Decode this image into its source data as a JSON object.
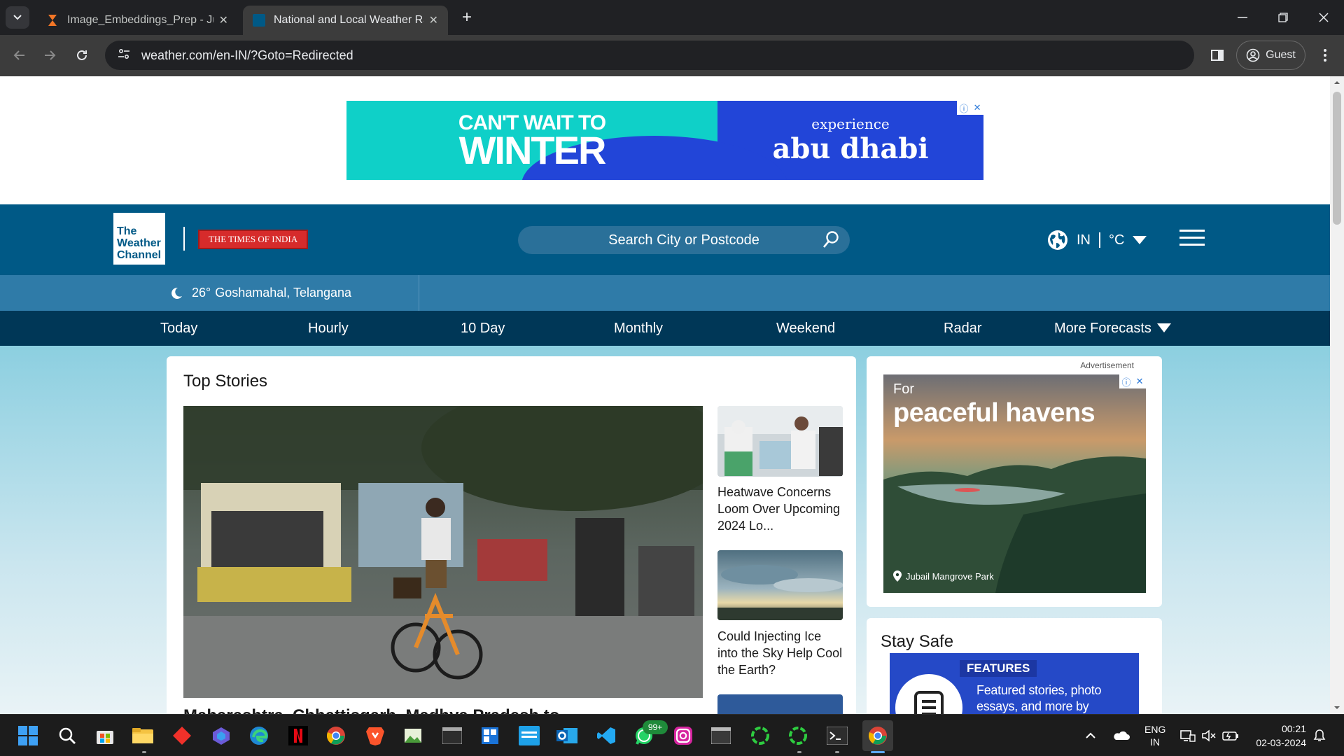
{
  "browser": {
    "tabs": [
      {
        "title": "Image_Embeddings_Prep - Jupyter",
        "active": false
      },
      {
        "title": "National and Local Weather Radar",
        "active": true
      }
    ],
    "new_tab": "+",
    "url": "weather.com/en-IN/?Goto=Redirected",
    "profile_label": "Guest",
    "window_controls": [
      "minimize",
      "restore",
      "close"
    ]
  },
  "top_ad": {
    "left_line1": "CAN'T WAIT TO",
    "left_line2": "WINTER",
    "right_line1": "experience",
    "right_line2": "abu dhabi"
  },
  "header": {
    "logo_lines": [
      "The",
      "Weather",
      "Channel"
    ],
    "partner": "THE TIMES OF INDIA",
    "search_placeholder": "Search City or Postcode",
    "region": "IN",
    "unit": "°C",
    "colors": {
      "primary": "#005986",
      "nav": "#003757",
      "location_bar": "#2f7ba8"
    }
  },
  "location": {
    "temp": "26°",
    "place": "Goshamahal, Telangana"
  },
  "forecast_nav": [
    "Today",
    "Hourly",
    "10 Day",
    "Monthly",
    "Weekend",
    "Radar",
    "More Forecasts"
  ],
  "stories": {
    "heading": "Top Stories",
    "hero_title": "Maharashtra, Chhattisgarh, Madhya Pradesh to",
    "side": [
      {
        "title": "Heatwave Concerns Loom Over Upcoming 2024 Lo..."
      },
      {
        "title": "Could Injecting Ice into the Sky Help Cool the Earth?"
      }
    ]
  },
  "side_ad": {
    "label": "Advertisement",
    "line1": "For",
    "line2": "peaceful havens",
    "place": "Jubail Mangrove Park"
  },
  "stay_safe": {
    "heading": "Stay Safe",
    "tag": "FEATURES",
    "desc_line1": "Featured stories, photo",
    "desc_line2": "essays, and more by"
  },
  "taskbar": {
    "badge": "99+",
    "lang_line1": "ENG",
    "lang_line2": "IN",
    "time": "00:21",
    "date": "02-03-2024"
  }
}
